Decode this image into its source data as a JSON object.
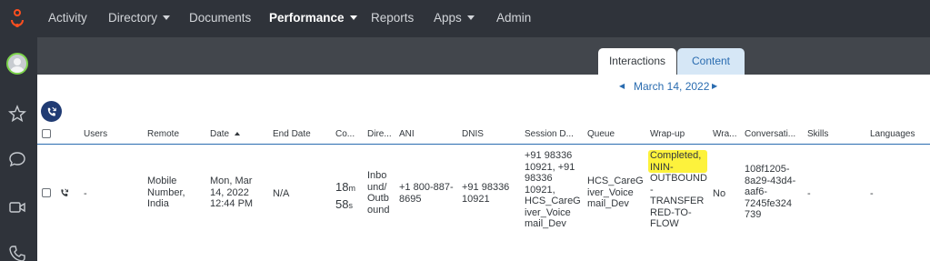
{
  "nav": {
    "items": [
      {
        "label": "Activity",
        "caret": false
      },
      {
        "label": "Directory",
        "caret": true
      },
      {
        "label": "Documents",
        "caret": false
      },
      {
        "label": "Performance",
        "caret": true,
        "active": true
      },
      {
        "label": "Reports",
        "caret": false
      },
      {
        "label": "Apps",
        "caret": true
      },
      {
        "label": "Admin",
        "caret": false
      }
    ]
  },
  "tabs": {
    "interactions": "Interactions",
    "content": "Content"
  },
  "date": {
    "label": "March 14, 2022",
    "prev": "◀",
    "next": "▶"
  },
  "columns": {
    "users": "Users",
    "remote": "Remote",
    "date": "Date",
    "end_date": "End Date",
    "duration": "Co...",
    "direction": "Dire...",
    "ani": "ANI",
    "dnis": "DNIS",
    "session": "Session D...",
    "queue": "Queue",
    "wrapup": "Wrap-up",
    "wra": "Wra...",
    "conversation": "Conversati...",
    "skills": "Skills",
    "languages": "Languages"
  },
  "row": {
    "users": "-",
    "remote": [
      "Mobile",
      "Number,",
      "India"
    ],
    "date": [
      "Mon, Mar",
      "14, 2022",
      "12:44 PM"
    ],
    "end_date": "N/A",
    "duration_min": "18",
    "duration_min_unit": "m",
    "duration_sec": "58",
    "duration_sec_unit": "s",
    "direction": [
      "Inbo",
      "und/",
      "Outb",
      "ound"
    ],
    "ani": [
      "+1 800-887-",
      "8695"
    ],
    "dnis": [
      "+91 98336",
      "10921"
    ],
    "session": [
      "+91 98336",
      "10921, +91",
      "98336",
      "10921,",
      "HCS_CareG",
      "iver_Voice",
      "mail_Dev"
    ],
    "queue": [
      "HCS_CareG",
      "iver_Voice",
      "mail_Dev"
    ],
    "wrapup_highlight": [
      "Completed,",
      "ININ-"
    ],
    "wrapup_rest": [
      "OUTBOUND",
      "-",
      "TRANSFER",
      "RED-TO-",
      "FLOW"
    ],
    "wra": "No",
    "conversation": [
      "108f1205-",
      "8a29-43d4-",
      "aaf6-",
      "7245fe324",
      "739"
    ],
    "skills": "-",
    "languages": "-"
  },
  "colors": {
    "nav_bg": "#2f333a",
    "tab_band": "#42464c",
    "accent": "#2a6cb0",
    "highlight": "#fdf23c",
    "logo": "#ff4f1f",
    "presence": "#7cd34b"
  }
}
